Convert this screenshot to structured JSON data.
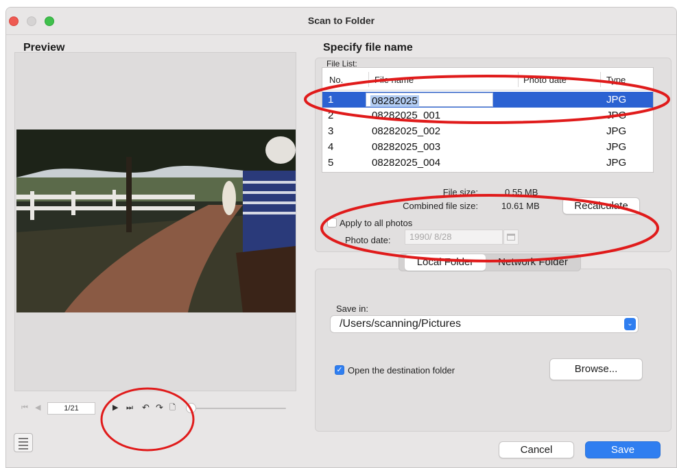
{
  "window": {
    "title": "Scan to Folder"
  },
  "preview": {
    "heading": "Preview",
    "page_indicator": "1/21",
    "controls": [
      "first-page-icon",
      "prev-page-icon",
      "next-page-icon",
      "last-page-icon",
      "rotate-left-icon",
      "rotate-right-icon",
      "delete-page-icon"
    ]
  },
  "file_panel": {
    "heading": "Specify file name",
    "file_list_label": "File List:",
    "columns": [
      "No.",
      "File name",
      "Photo date",
      "Type"
    ],
    "rows": [
      {
        "no": "1",
        "name": "08282025",
        "date": "",
        "type": "JPG",
        "selected": true
      },
      {
        "no": "2",
        "name": "08282025_001",
        "date": "",
        "type": "JPG"
      },
      {
        "no": "3",
        "name": "08282025_002",
        "date": "",
        "type": "JPG"
      },
      {
        "no": "4",
        "name": "08282025_003",
        "date": "",
        "type": "JPG"
      },
      {
        "no": "5",
        "name": "08282025_004",
        "date": "",
        "type": "JPG"
      }
    ],
    "file_size_label": "File size:",
    "file_size_value": "0.55  MB",
    "combined_label": "Combined file size:",
    "combined_value": "10.61  MB",
    "recalculate_label": "Recalculate",
    "apply_all_label": "Apply to all photos",
    "photo_date_label": "Photo date:",
    "photo_date_value": "1990/  8/28"
  },
  "destination": {
    "tabs": [
      "Local Folder",
      "Network Folder"
    ],
    "active_tab": "Local Folder",
    "save_in_label": "Save in:",
    "save_in_path": "/Users/scanning/Pictures",
    "open_folder_label": "Open the destination folder",
    "open_folder_checked": true,
    "browse_label": "Browse..."
  },
  "footer": {
    "cancel_label": "Cancel",
    "save_label": "Save"
  },
  "colors": {
    "accent": "#2f7ef0",
    "selection": "#2b62d2",
    "annotation": "#e01b1b"
  }
}
